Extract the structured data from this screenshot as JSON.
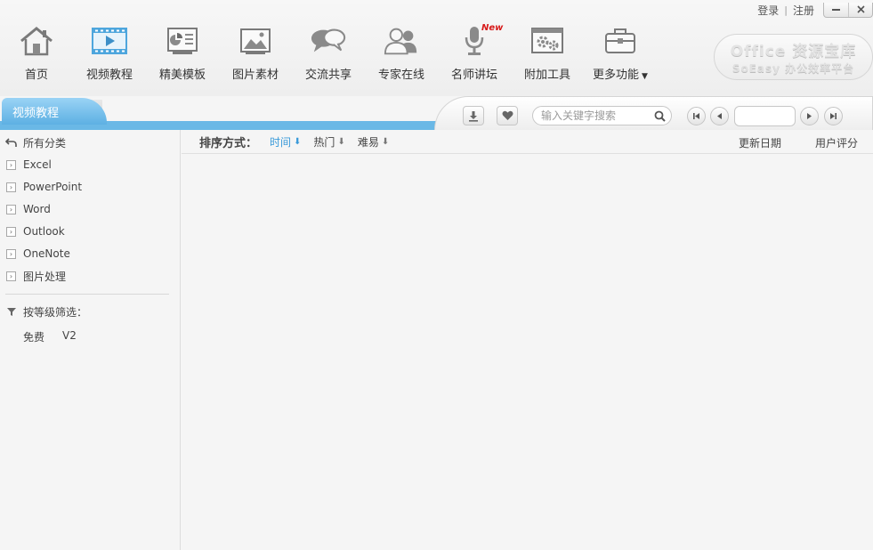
{
  "window": {
    "login_label": "登录",
    "register_label": "注册",
    "minimize_icon": "minimize-icon",
    "close_icon": "close-icon"
  },
  "nav": {
    "items": [
      {
        "label": "首页",
        "icon": "home-icon"
      },
      {
        "label": "视频教程",
        "icon": "video-icon"
      },
      {
        "label": "精美模板",
        "icon": "template-icon"
      },
      {
        "label": "图片素材",
        "icon": "picture-icon"
      },
      {
        "label": "交流共享",
        "icon": "chat-icon"
      },
      {
        "label": "专家在线",
        "icon": "experts-icon"
      },
      {
        "label": "名师讲坛",
        "icon": "microphone-icon",
        "badge": "New"
      },
      {
        "label": "附加工具",
        "icon": "tools-icon"
      },
      {
        "label": "更多功能",
        "icon": "toolbox-icon"
      }
    ]
  },
  "brand": {
    "line1": "Office 资源宝库",
    "line2": "SoEasy 办公效率平台"
  },
  "tab": {
    "active_label": "视频教程"
  },
  "search": {
    "placeholder": "输入关键字搜索"
  },
  "sidebar": {
    "all_label": "所有分类",
    "items": [
      {
        "label": "Excel"
      },
      {
        "label": "PowerPoint"
      },
      {
        "label": "Word"
      },
      {
        "label": "Outlook"
      },
      {
        "label": "OneNote"
      },
      {
        "label": "图片处理"
      }
    ],
    "filter_title": "按等级筛选：",
    "filter_options": [
      "免费",
      "V2"
    ]
  },
  "sort": {
    "title": "排序方式：",
    "options": [
      {
        "label": "时间",
        "active": true
      },
      {
        "label": "热门",
        "active": false
      },
      {
        "label": "难易",
        "active": false
      }
    ],
    "columns": [
      "更新日期",
      "用户评分"
    ]
  },
  "colors": {
    "accent": "#5db0e3",
    "active_sort": "#3a9ad9",
    "new_badge": "#d71a1a"
  }
}
